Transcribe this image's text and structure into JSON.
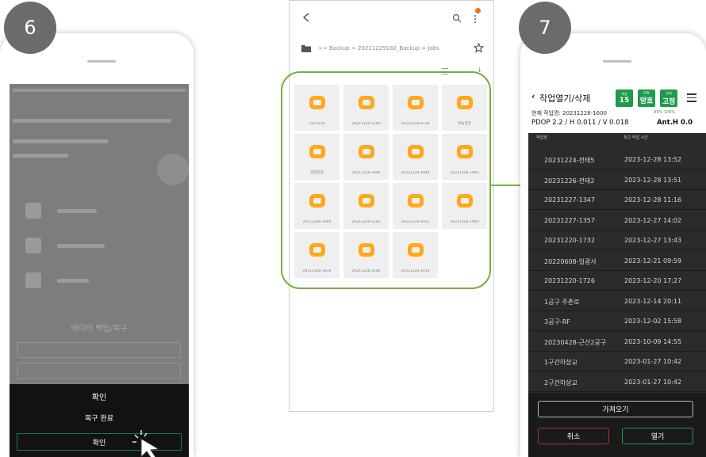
{
  "steps": {
    "left": "6",
    "right": "7"
  },
  "phone6": {
    "backup_section_title": "데이터 백업/복구",
    "dialog": {
      "title": "확인",
      "message": "복구 완료",
      "ok_label": "확인"
    }
  },
  "file_manager": {
    "breadcrumb": ">> Backup > 20211229182_Backup > Jobs",
    "folders": [
      "xxx1318",
      "20211129-1500",
      "20211228-0114",
      "연습현장",
      "현장작업",
      "20211228-1946",
      "20211228-1944",
      "20211228-1942",
      "20211228-1940",
      "20211229-1502",
      "20211228-1911",
      "20211228-1949",
      "20211228-1830",
      "20211228-1500",
      "20211228-1014"
    ]
  },
  "phone7": {
    "title": "작업열기/삭제",
    "btn1": {
      "top": "위성",
      "main": "15"
    },
    "btn2": {
      "top": "RTK",
      "main": "양호"
    },
    "btn3": {
      "top": "상태",
      "main": "고정"
    },
    "current_job": "현재 작업명: 20231228-1600",
    "battery": "93% 100%",
    "precision": "PDOP 2.2 / H 0.011 / V 0.018",
    "antenna": "Ant.H 0.0",
    "col_job": "작업명",
    "col_time": "최근 작업 시간",
    "rows": [
      {
        "name": "20231224-전태5",
        "time": "2023-12-28 13:52"
      },
      {
        "name": "20231226-전태2",
        "time": "2023-12-28 13:51"
      },
      {
        "name": "20231227-1347",
        "time": "2023-12-28 11:16"
      },
      {
        "name": "20231227-1357",
        "time": "2023-12-27 14:02"
      },
      {
        "name": "20231220-1732",
        "time": "2023-12-27 13:43"
      },
      {
        "name": "20220608-일광사",
        "time": "2023-12-21 09:59"
      },
      {
        "name": "20231220-1726",
        "time": "2023-12-20 17:27"
      },
      {
        "name": "1공구 주촌로",
        "time": "2023-12-14 20:11"
      },
      {
        "name": "3공구-RF",
        "time": "2023-12-02 15:58"
      },
      {
        "name": "20230428-근산2공구",
        "time": "2023-10-09 14:55"
      },
      {
        "name": "1구간하상교",
        "time": "2023-01-27 10:42"
      },
      {
        "name": "2구간하상교",
        "time": "2023-01-27 10:42"
      }
    ],
    "import_label": "가져오기",
    "cancel_label": "취소",
    "open_label": "열기"
  },
  "colors": {
    "accent_green": "#76b041",
    "button_green": "#1e9b4b",
    "folder_orange": "#ffa81a",
    "badge_gray": "#6b6b6b"
  }
}
